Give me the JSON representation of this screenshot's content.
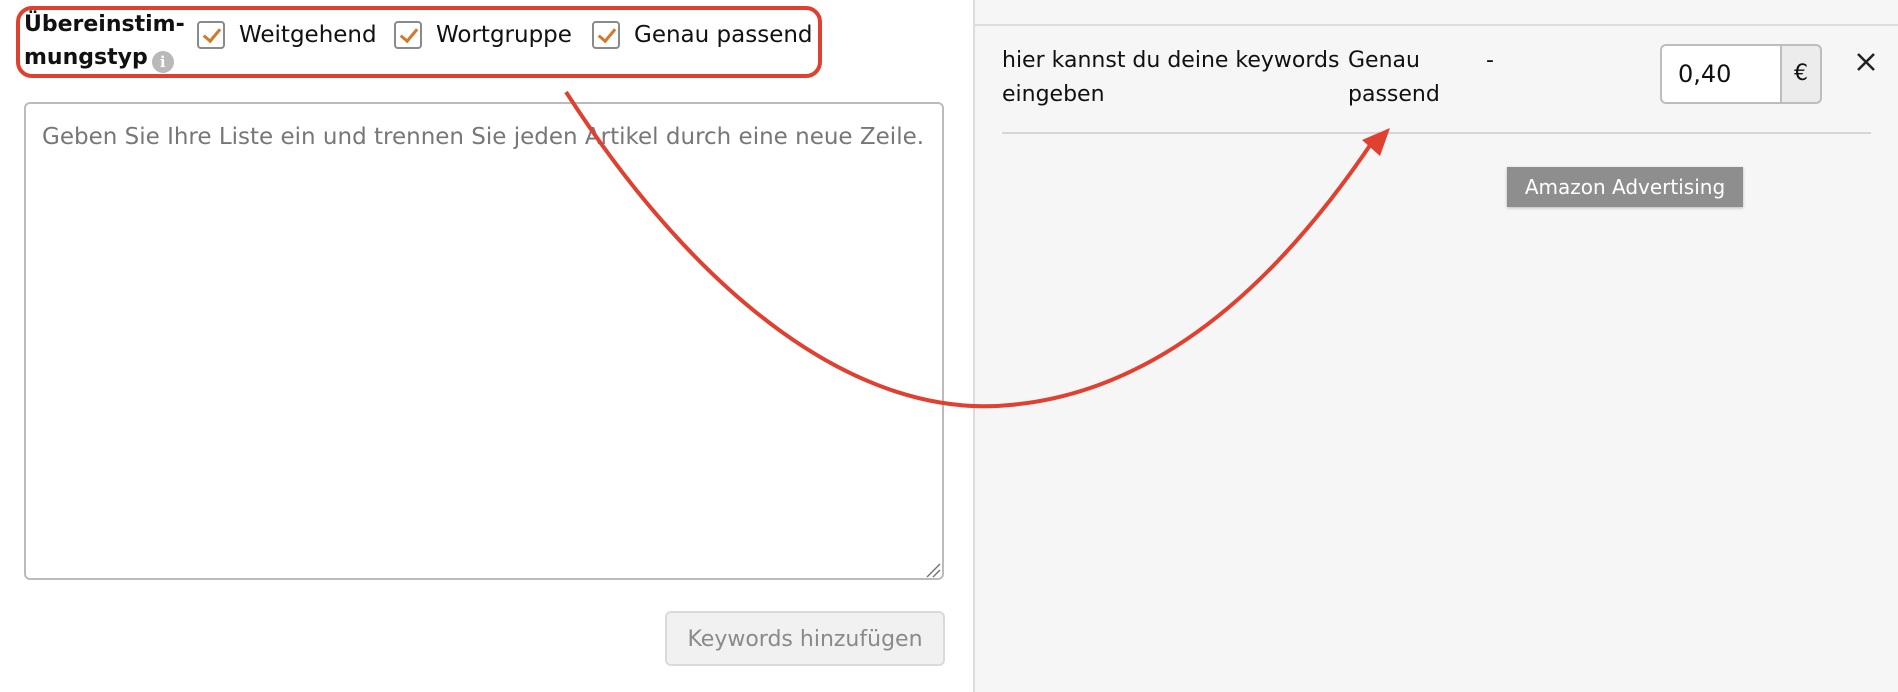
{
  "match_type": {
    "label": "Übereinstim-mungstyp",
    "options": [
      {
        "label": "Weitgehend",
        "checked": true
      },
      {
        "label": "Wortgruppe",
        "checked": true
      },
      {
        "label": "Genau passend",
        "checked": true
      }
    ]
  },
  "keyword_input": {
    "placeholder": "Geben Sie Ihre Liste ein und trennen Sie jeden Artikel durch eine neue Zeile.",
    "value": ""
  },
  "add_button": {
    "label": "Keywords hinzufügen"
  },
  "keyword_row": {
    "keyword": "hier kannst du deine keywords eingeben",
    "match_type": "Genau passend",
    "suggested": "-",
    "bid": "0,40",
    "currency": "€"
  },
  "watermark": {
    "text": "Amazon Advertising"
  },
  "colors": {
    "highlight": "#e04030",
    "checkmark": "#d07a2a"
  },
  "icons": [
    "info-icon",
    "checkmark-icon",
    "close-icon",
    "resize-handle-icon",
    "arrow-annotation"
  ]
}
